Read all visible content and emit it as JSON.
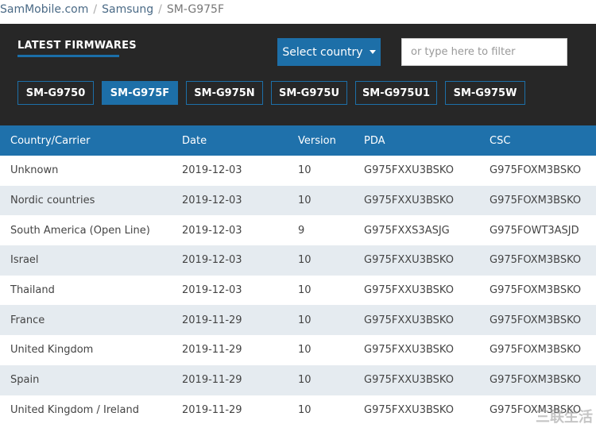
{
  "breadcrumb": {
    "items": [
      "SamMobile.com",
      "Samsung"
    ],
    "current": "SM-G975F"
  },
  "panel": {
    "title": "LATEST FIRMWARES",
    "country_button": "Select country",
    "filter_placeholder": "or type here to filter",
    "models": [
      {
        "label": "SM-G9750",
        "active": false
      },
      {
        "label": "SM-G975F",
        "active": true
      },
      {
        "label": "SM-G975N",
        "active": false
      },
      {
        "label": "SM-G975U",
        "active": false
      },
      {
        "label": "SM-G975U1",
        "active": false
      },
      {
        "label": "SM-G975W",
        "active": false
      }
    ]
  },
  "table": {
    "headers": [
      "Country/Carrier",
      "Date",
      "Version",
      "PDA",
      "CSC"
    ],
    "rows": [
      [
        "Unknown",
        "2019-12-03",
        "10",
        "G975FXXU3BSKO",
        "G975FOXM3BSKO"
      ],
      [
        "Nordic countries",
        "2019-12-03",
        "10",
        "G975FXXU3BSKO",
        "G975FOXM3BSKO"
      ],
      [
        "South America (Open Line)",
        "2019-12-03",
        "9",
        "G975FXXS3ASJG",
        "G975FOWT3ASJD"
      ],
      [
        "Israel",
        "2019-12-03",
        "10",
        "G975FXXU3BSKO",
        "G975FOXM3BSKO"
      ],
      [
        "Thailand",
        "2019-12-03",
        "10",
        "G975FXXU3BSKO",
        "G975FOXM3BSKO"
      ],
      [
        "France",
        "2019-11-29",
        "10",
        "G975FXXU3BSKO",
        "G975FOXM3BSKO"
      ],
      [
        "United Kingdom",
        "2019-11-29",
        "10",
        "G975FXXU3BSKO",
        "G975FOXM3BSKO"
      ],
      [
        "Spain",
        "2019-11-29",
        "10",
        "G975FXXU3BSKO",
        "G975FOXM3BSKO"
      ],
      [
        "United Kingdom / Ireland",
        "2019-11-29",
        "10",
        "G975FXXU3BSKO",
        "G975FOXM3BSKO"
      ]
    ]
  },
  "watermark": "三联生活",
  "colors": {
    "accent": "#1d6fa8",
    "panel": "#272727",
    "stripe": "#e5ebf0"
  }
}
